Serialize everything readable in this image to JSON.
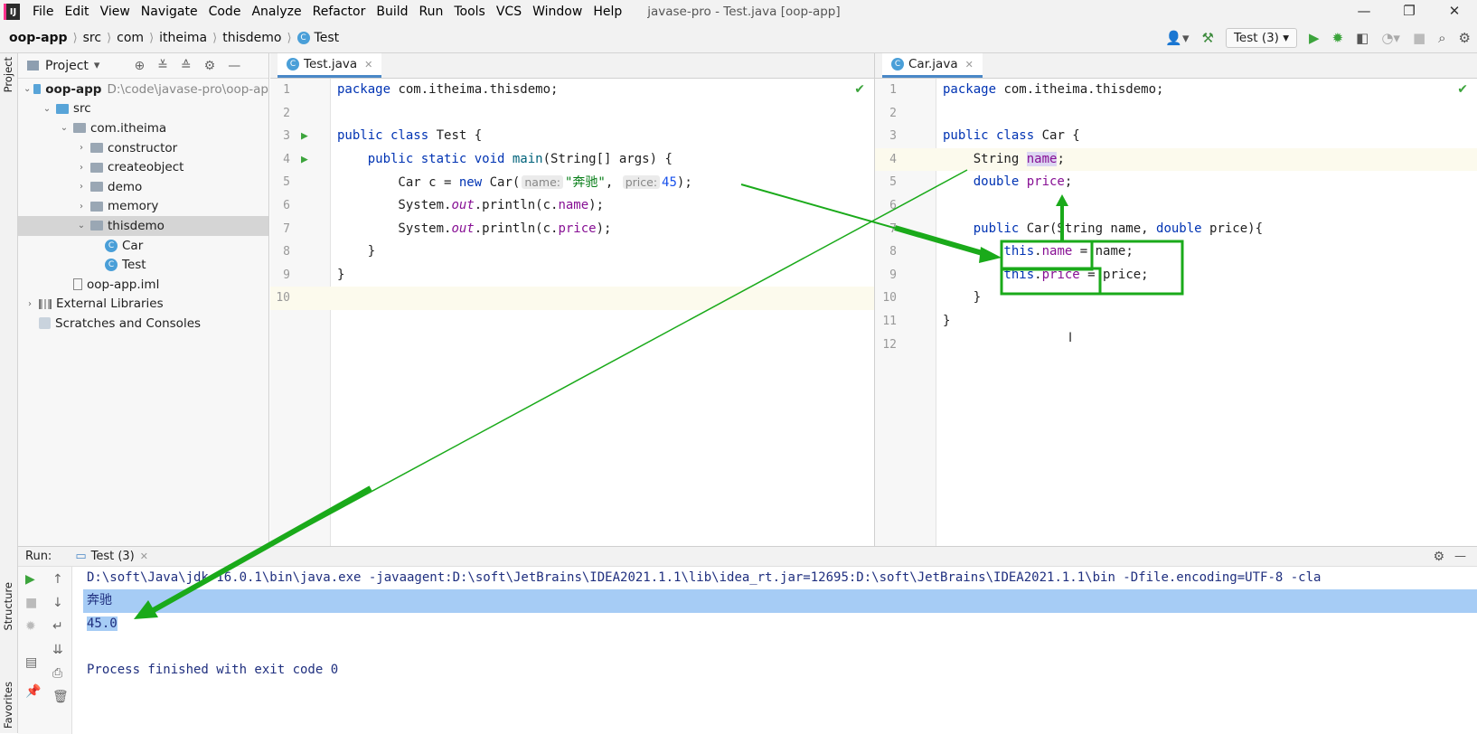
{
  "menubar": {
    "logo": "IJ",
    "items": [
      "File",
      "Edit",
      "View",
      "Navigate",
      "Code",
      "Analyze",
      "Refactor",
      "Build",
      "Run",
      "Tools",
      "VCS",
      "Window",
      "Help"
    ],
    "window_title": "javase-pro - Test.java [oop-app]",
    "controls": {
      "minimize": "—",
      "restore": "❐",
      "close": "✕"
    }
  },
  "breadcrumb": [
    "oop-app",
    "src",
    "com",
    "itheima",
    "thisdemo",
    "Test"
  ],
  "toolbar": {
    "run_config": "Test (3)"
  },
  "side_labels": {
    "project": "Project",
    "structure": "Structure",
    "favorites": "Favorites"
  },
  "project_panel": {
    "title": "Project",
    "tree": [
      {
        "label": "oop-app",
        "path": "D:\\code\\javase-pro\\oop-ap",
        "indent": 0,
        "arrow": "v",
        "type": "module"
      },
      {
        "label": "src",
        "indent": 1,
        "arrow": "v",
        "type": "srcfolder"
      },
      {
        "label": "com.itheima",
        "indent": 2,
        "arrow": "v",
        "type": "package"
      },
      {
        "label": "constructor",
        "indent": 3,
        "arrow": ">",
        "type": "package"
      },
      {
        "label": "createobject",
        "indent": 3,
        "arrow": ">",
        "type": "package"
      },
      {
        "label": "demo",
        "indent": 3,
        "arrow": ">",
        "type": "package"
      },
      {
        "label": "memory",
        "indent": 3,
        "arrow": ">",
        "type": "package"
      },
      {
        "label": "thisdemo",
        "indent": 3,
        "arrow": "v",
        "type": "package",
        "selected": true
      },
      {
        "label": "Car",
        "indent": 4,
        "arrow": "",
        "type": "class"
      },
      {
        "label": "Test",
        "indent": 4,
        "arrow": "",
        "type": "class"
      },
      {
        "label": "oop-app.iml",
        "indent": 2,
        "arrow": "",
        "type": "file"
      },
      {
        "label": "External Libraries",
        "indent": 0,
        "arrow": ">",
        "type": "lib"
      },
      {
        "label": "Scratches and Consoles",
        "indent": 0,
        "arrow": "",
        "type": "scratch"
      }
    ]
  },
  "left_editor": {
    "tab": "Test.java",
    "lines": [
      "1",
      "2",
      "3",
      "4",
      "5",
      "6",
      "7",
      "8",
      "9",
      "10"
    ],
    "code": {
      "l1_kw": "package",
      "l1_rest": " com.itheima.thisdemo;",
      "l3_kw": "public class",
      "l3_rest": " Test {",
      "l4_kw1": "    public static void",
      "l4_m": " main",
      "l4_rest": "(String[] args) {",
      "l5_a": "        Car c = ",
      "l5_new": "new",
      "l5_b": " Car(",
      "l5_hint1": "name:",
      "l5_str": "\"奔驰\"",
      "l5_c": ", ",
      "l5_hint2": "price:",
      "l5_num": "45",
      "l5_d": ");",
      "l6_a": "        System.",
      "l6_out": "out",
      "l6_b": ".println(c.",
      "l6_f": "name",
      "l6_c": ");",
      "l7_a": "        System.",
      "l7_out": "out",
      "l7_b": ".println(c.",
      "l7_f": "price",
      "l7_c": ");",
      "l8": "    }",
      "l9": "}"
    }
  },
  "right_editor": {
    "tab": "Car.java",
    "lines": [
      "1",
      "2",
      "3",
      "4",
      "5",
      "6",
      "7",
      "8",
      "9",
      "10",
      "11",
      "12"
    ],
    "code": {
      "l1_kw": "package",
      "l1_rest": " com.itheima.thisdemo;",
      "l3_kw": "public class",
      "l3_rest": " Car {",
      "l4_a": "    String ",
      "l4_f": "name",
      "l4_b": ";",
      "l5_kw": "    double ",
      "l5_f": "price",
      "l5_b": ";",
      "l7_kw": "    public ",
      "l7_b": "Car(String name, ",
      "l7_kw2": "double",
      "l7_c": " price){",
      "l8_kw": "        this",
      "l8_dot": ".",
      "l8_f": "name",
      "l8_rest": " = name;",
      "l9_kw": "        this",
      "l9_dot": ".",
      "l9_f": "price",
      "l9_rest": " = price;",
      "l10": "    }",
      "l11": "}"
    }
  },
  "run_panel": {
    "label": "Run:",
    "tab": "Test (3)",
    "console": [
      "D:\\soft\\Java\\jdk-16.0.1\\bin\\java.exe -javaagent:D:\\soft\\JetBrains\\IDEA2021.1.1\\lib\\idea_rt.jar=12695:D:\\soft\\JetBrains\\IDEA2021.1.1\\bin -Dfile.encoding=UTF-8 -cla",
      "奔驰",
      "45.0",
      "",
      "Process finished with exit code 0"
    ]
  },
  "colors": {
    "annotation_green": "#1aaa1a",
    "keyword": "#0033b3",
    "field": "#871094",
    "string": "#067d17"
  }
}
